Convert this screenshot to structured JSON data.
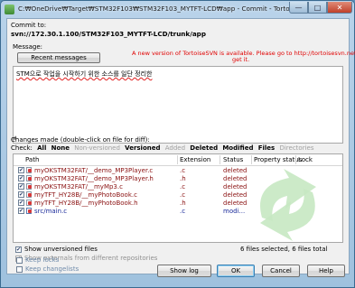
{
  "window": {
    "title": "C:₩OneDrive₩Target₩STM32F103₩STM32F103_MYTFT-LCD₩app - Commit - TortoiseSVN",
    "minimize_label": "—",
    "maximize_label": "□",
    "close_label": "✕"
  },
  "commit": {
    "to_label": "Commit to:",
    "url": "svn://172.30.1.100/STM32F103_MYTFT-LCD/trunk/app"
  },
  "message": {
    "label": "Message:",
    "recent_button": "Recent messages",
    "update_notice_line1": "A new version of TortoiseSVN is available. Please go to http://tortoisesvn.net to",
    "update_notice_line2": "get it.",
    "text": "STM으로 작업을 시작하기 위한 소스를 일단 정리한"
  },
  "changes": {
    "label": "Changes made (double-click on file for diff):",
    "check_label": "Check:",
    "filters": [
      {
        "label": "All",
        "state": "active"
      },
      {
        "label": "None",
        "state": "active"
      },
      {
        "label": "Non-versioned",
        "state": "inactive"
      },
      {
        "label": "Versioned",
        "state": "active"
      },
      {
        "label": "Added",
        "state": "inactive"
      },
      {
        "label": "Deleted",
        "state": "active"
      },
      {
        "label": "Modified",
        "state": "active"
      },
      {
        "label": "Files",
        "state": "active"
      },
      {
        "label": "Directories",
        "state": "inactive"
      }
    ],
    "columns": {
      "path": "Path",
      "extension": "Extension",
      "status": "Status",
      "property_status": "Property status",
      "lock": "Lock"
    },
    "rows": [
      {
        "path": "myOKSTM32FAT/__demo_MP3Player.c",
        "extension": ".c",
        "status": "deleted",
        "checked": true
      },
      {
        "path": "myOKSTM32FAT/__demo_MP3Player.h",
        "extension": ".h",
        "status": "deleted",
        "checked": true
      },
      {
        "path": "myOKSTM32FAT/__myMp3.c",
        "extension": ".c",
        "status": "deleted",
        "checked": true
      },
      {
        "path": "myTFT_HY28B/__myPhotoBook.c",
        "extension": ".c",
        "status": "deleted",
        "checked": true
      },
      {
        "path": "myTFT_HY28B/__myPhotoBook.h",
        "extension": ".h",
        "status": "deleted",
        "checked": true
      },
      {
        "path": "src/main.c",
        "extension": ".c",
        "status": "modi...",
        "checked": true
      }
    ],
    "show_unversioned": "Show unversioned files",
    "show_unversioned_checked": true,
    "show_externals": "Show externals from different repositories",
    "show_externals_checked": true,
    "summary": "6 files selected, 6 files total"
  },
  "footer": {
    "keep_locks": "Keep locks",
    "keep_changelists": "Keep changelists",
    "show_log": "Show log",
    "ok": "OK",
    "cancel": "Cancel",
    "help": "Help"
  },
  "colors": {
    "notice": "#e00000",
    "deleted": "#8a1010",
    "modified": "#1a2a9a"
  }
}
